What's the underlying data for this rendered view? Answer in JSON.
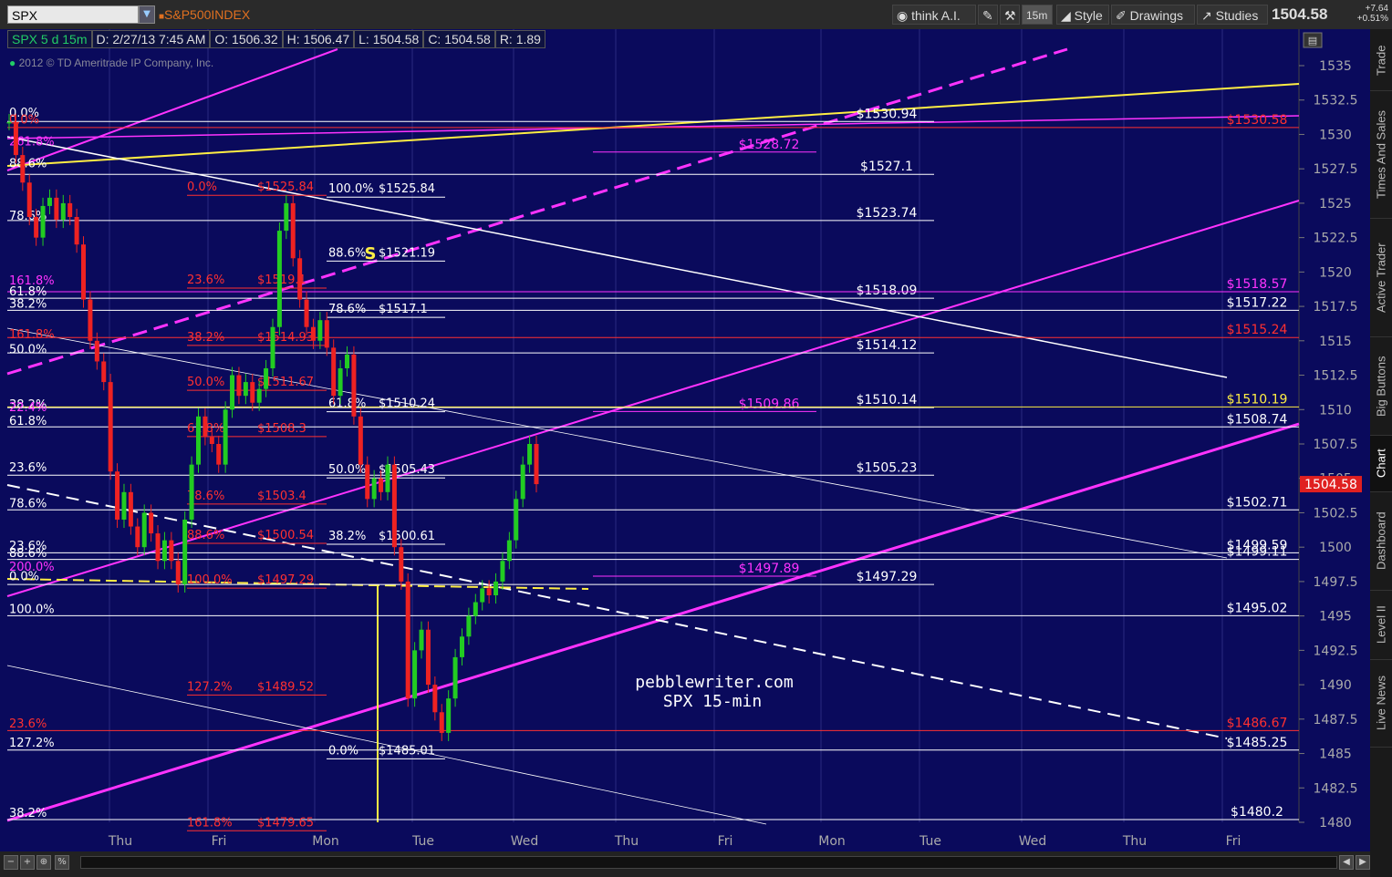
{
  "toolbar": {
    "symbol": "SPX",
    "description": "S&P500INDEX",
    "think_ai": "think A.I.",
    "timeframe": "15m",
    "style": "Style",
    "drawings": "Drawings",
    "studies": "Studies",
    "last_price": "1504.58",
    "change": "+7.64",
    "change_pct": "+0.51%"
  },
  "info": {
    "period": "SPX 5 d 15m",
    "date": "D: 2/27/13 7:45 AM",
    "open": "O: 1506.32",
    "high": "H: 1506.47",
    "low": "L: 1504.58",
    "close": "C: 1504.58",
    "range": "R: 1.89",
    "copyright": "2012 © TD Ameritrade IP Company, Inc."
  },
  "sidebar_tabs": [
    "Trade",
    "Times And Sales",
    "Active Trader",
    "Big Buttons",
    "Chart",
    "Dashboard",
    "Level II",
    "Live News"
  ],
  "watermark": [
    "pebblewriter.com",
    "SPX 15-min"
  ],
  "colors": {
    "background": "#0a0a5c",
    "white": "#ffffff",
    "magenta": "#ff33ff",
    "red": "#ff3030",
    "yellow": "#ffee44",
    "up": "#22cc22",
    "down": "#ee2222"
  },
  "chart_data": {
    "type": "line",
    "title": "",
    "xlabel": "",
    "ylabel": "",
    "ylim": [
      1480,
      1537
    ],
    "y_ticks": [
      1480,
      1482.5,
      1485,
      1487.5,
      1490,
      1492.5,
      1495,
      1497.5,
      1500,
      1502.5,
      1505,
      1507.5,
      1510,
      1512.5,
      1515,
      1517.5,
      1520,
      1522.5,
      1525,
      1527.5,
      1530,
      1532.5,
      1535
    ],
    "x_labels": [
      "Thu",
      "Fri",
      "Mon",
      "Tue",
      "Wed",
      "Thu",
      "Fri",
      "Mon",
      "Tue",
      "Wed",
      "Thu",
      "Fri"
    ],
    "last_price_label": "1504.58",
    "series": [
      {
        "name": "SPX",
        "values": [
          1530.9,
          1528.5,
          1526.5,
          1524.0,
          1522.5,
          1524.8,
          1525.4,
          1523.8,
          1525.0,
          1524.0,
          1522.0,
          1518.0,
          1515.0,
          1513.5,
          1512.0,
          1505.5,
          1502.0,
          1504.0,
          1501.5,
          1500.0,
          1502.5,
          1501.0,
          1499.0,
          1500.5,
          1499.0,
          1497.3,
          1502.0,
          1506.0,
          1509.5,
          1508.0,
          1507.5,
          1506.0,
          1510.0,
          1512.5,
          1511.0,
          1512.0,
          1510.5,
          1511.5,
          1513.0,
          1516.0,
          1523.0,
          1525.0,
          1521.0,
          1518.0,
          1516.0,
          1515.0,
          1516.5,
          1514.5,
          1511.0,
          1513.0,
          1514.0,
          1509.5,
          1506.0,
          1503.5,
          1505.0,
          1504.0,
          1506.0,
          1500.0,
          1497.5,
          1489.0,
          1492.5,
          1494.0,
          1490.0,
          1488.0,
          1486.5,
          1489.0,
          1492.0,
          1493.5,
          1495.0,
          1496.0,
          1497.0,
          1496.5,
          1497.5,
          1499.0,
          1500.5,
          1503.5,
          1506.0,
          1507.5,
          1504.58
        ]
      }
    ],
    "horizontal_levels": [
      {
        "value": 1530.94,
        "label": "$1530.94",
        "color": "white"
      },
      {
        "value": 1527.1,
        "label": "$1527.1",
        "color": "white"
      },
      {
        "value": 1523.74,
        "label": "$1523.74",
        "color": "white"
      },
      {
        "value": 1518.09,
        "label": "$1518.09",
        "color": "white"
      },
      {
        "value": 1514.12,
        "label": "$1514.12",
        "color": "white"
      },
      {
        "value": 1510.14,
        "label": "$1510.14",
        "color": "white"
      },
      {
        "value": 1505.23,
        "label": "$1505.23",
        "color": "white"
      },
      {
        "value": 1497.29,
        "label": "$1497.29",
        "color": "white"
      },
      {
        "value": 1528.72,
        "label": "$1528.72",
        "color": "magenta"
      },
      {
        "value": 1509.86,
        "label": "$1509.86",
        "color": "magenta"
      },
      {
        "value": 1497.89,
        "label": "$1497.89",
        "color": "magenta"
      },
      {
        "value": 1518.57,
        "label": "$1518.57",
        "color": "magenta"
      },
      {
        "value": 1517.22,
        "label": "$1517.22",
        "color": "white"
      },
      {
        "value": 1515.24,
        "label": "$1515.24",
        "color": "red"
      },
      {
        "value": 1510.19,
        "label": "$1510.19",
        "color": "yellow"
      },
      {
        "value": 1508.74,
        "label": "$1508.74",
        "color": "white"
      },
      {
        "value": 1502.71,
        "label": "$1502.71",
        "color": "white"
      },
      {
        "value": 1499.59,
        "label": "$1499.59",
        "color": "white"
      },
      {
        "value": 1499.11,
        "label": "$1499.11",
        "color": "white"
      },
      {
        "value": 1495.02,
        "label": "$1495.02",
        "color": "white"
      },
      {
        "value": 1486.67,
        "label": "$1486.67",
        "color": "red"
      },
      {
        "value": 1485.25,
        "label": "$1485.25",
        "color": "white"
      },
      {
        "value": 1480.2,
        "label": "$1480.2",
        "color": "white"
      },
      {
        "value": 1530.5,
        "label": "$1530.58",
        "color": "red"
      }
    ],
    "fib_left": [
      {
        "value": 1531.1,
        "label": "0.0%",
        "color": "white"
      },
      {
        "value": 1530.6,
        "label": "0.0%",
        "color": "red"
      },
      {
        "value": 1529.0,
        "label": "261.8%",
        "color": "magenta"
      },
      {
        "value": 1527.4,
        "label": "88.6%",
        "color": "white"
      },
      {
        "value": 1523.6,
        "label": "78.6%",
        "color": "white"
      },
      {
        "value": 1518.9,
        "label": "161.8%",
        "color": "magenta"
      },
      {
        "value": 1518.1,
        "label": "61.8%",
        "color": "white"
      },
      {
        "value": 1517.2,
        "label": "38.2%",
        "color": "white"
      },
      {
        "value": 1515.0,
        "label": "161.8%",
        "color": "red"
      },
      {
        "value": 1513.9,
        "label": "50.0%",
        "color": "white"
      },
      {
        "value": 1509.9,
        "label": "38.2%",
        "color": "white"
      },
      {
        "value": 1509.7,
        "label": "22.4%",
        "color": "magenta"
      },
      {
        "value": 1508.7,
        "label": "61.8%",
        "color": "white"
      },
      {
        "value": 1505.3,
        "label": "23.6%",
        "color": "white"
      },
      {
        "value": 1502.7,
        "label": "78.6%",
        "color": "white"
      },
      {
        "value": 1499.6,
        "label": "23.6%",
        "color": "white"
      },
      {
        "value": 1499.1,
        "label": "88.6%",
        "color": "white"
      },
      {
        "value": 1498.1,
        "label": "200.0%",
        "color": "magenta"
      },
      {
        "value": 1497.4,
        "label": "0.0%",
        "color": "white"
      },
      {
        "value": 1495.0,
        "label": "100.0%",
        "color": "white"
      },
      {
        "value": 1486.7,
        "label": "23.6%",
        "color": "red"
      },
      {
        "value": 1485.3,
        "label": "127.2%",
        "color": "white"
      },
      {
        "value": 1480.2,
        "label": "38.2%",
        "color": "white"
      }
    ],
    "fib_red": [
      {
        "value": 1525.84,
        "pct": "0.0%",
        "price": "$1525.84"
      },
      {
        "value": 1519.1,
        "pct": "23.6%",
        "price": "$1519.1"
      },
      {
        "value": 1514.93,
        "pct": "38.2%",
        "price": "$1514.93"
      },
      {
        "value": 1511.67,
        "pct": "50.0%",
        "price": "$1511.67"
      },
      {
        "value": 1508.3,
        "pct": "61.8%",
        "price": "$1508.3"
      },
      {
        "value": 1503.4,
        "pct": "78.6%",
        "price": "$1503.4"
      },
      {
        "value": 1500.54,
        "pct": "88.6%",
        "price": "$1500.54"
      },
      {
        "value": 1497.29,
        "pct": "100.0%",
        "price": "$1497.29"
      },
      {
        "value": 1489.52,
        "pct": "127.2%",
        "price": "$1489.52"
      },
      {
        "value": 1479.65,
        "pct": "161.8%",
        "price": "$1479.65"
      }
    ],
    "fib_white": [
      {
        "value": 1525.84,
        "pct": "100.0%",
        "price": "$1525.84"
      },
      {
        "value": 1521.19,
        "pct": "88.6%",
        "price": "$1521.19"
      },
      {
        "value": 1517.1,
        "pct": "78.6%",
        "price": "$1517.1"
      },
      {
        "value": 1510.24,
        "pct": "61.8%",
        "price": "$1510.24"
      },
      {
        "value": 1505.43,
        "pct": "50.0%",
        "price": "$1505.43"
      },
      {
        "value": 1500.61,
        "pct": "38.2%",
        "price": "$1500.61"
      },
      {
        "value": 1485.01,
        "pct": "0.0%",
        "price": "$1485.01"
      }
    ],
    "annotation": "S"
  }
}
